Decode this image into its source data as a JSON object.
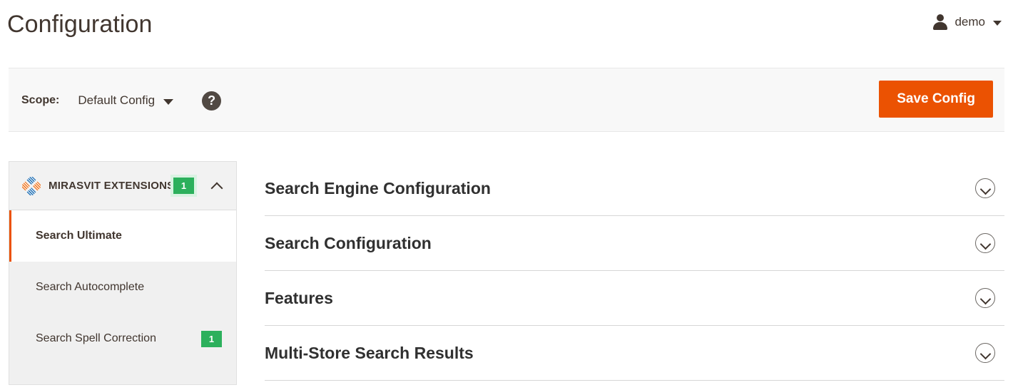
{
  "header": {
    "title": "Configuration",
    "user": {
      "name": "demo",
      "avatar_icon": "user-avatar-icon",
      "caret_icon": "caret-down-icon"
    }
  },
  "scope_bar": {
    "label": "Scope:",
    "selected": "Default Config",
    "caret_icon": "caret-down-icon",
    "help_icon": "?",
    "save_button": "Save Config",
    "save_button_color": "#eb5202"
  },
  "sidebar": {
    "group": {
      "title": "MIRASVIT EXTENSIONS",
      "logo_icon": "mirasvit-diamond-logo",
      "badge": "1",
      "collapse_icon": "chevron-up-icon"
    },
    "items": [
      {
        "label": "Search Ultimate",
        "active": true,
        "badge": null
      },
      {
        "label": "Search Autocomplete",
        "active": false,
        "badge": null
      },
      {
        "label": "Search Spell Correction",
        "active": false,
        "badge": "1"
      }
    ],
    "badge_color": "#2cb05c",
    "active_marker_color": "#eb5202"
  },
  "main": {
    "sections": [
      {
        "title": "Search Engine Configuration",
        "toggle_icon": "chevron-down-circle-icon"
      },
      {
        "title": "Search Configuration",
        "toggle_icon": "chevron-down-circle-icon"
      },
      {
        "title": "Features",
        "toggle_icon": "chevron-down-circle-icon"
      },
      {
        "title": "Multi-Store Search Results",
        "toggle_icon": "chevron-down-circle-icon"
      }
    ]
  }
}
